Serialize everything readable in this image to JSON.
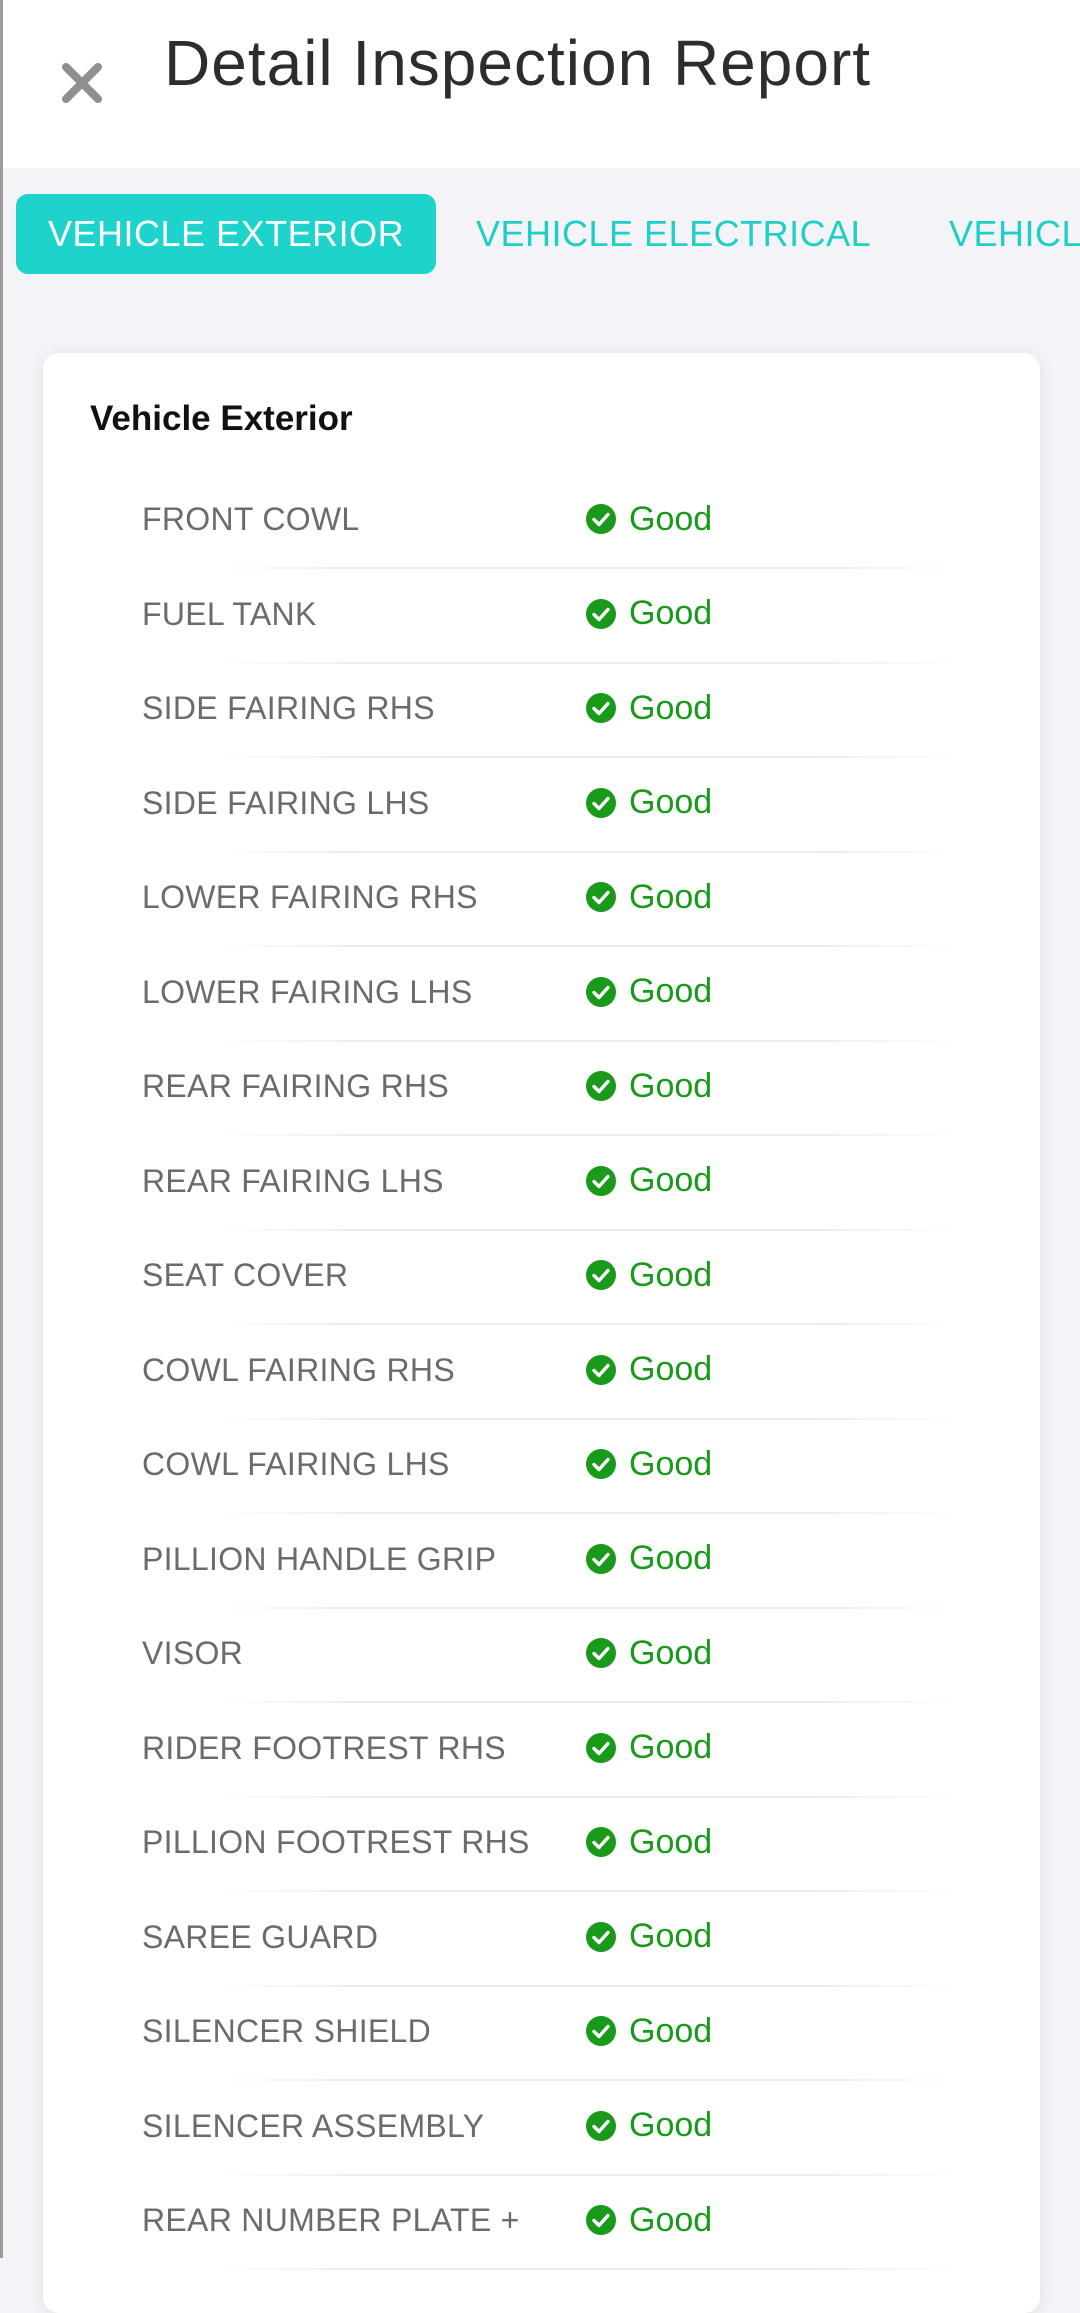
{
  "header": {
    "title": "Detail Inspection Report",
    "close_icon": "close-icon"
  },
  "tabs": [
    {
      "label": "VEHICLE EXTERIOR",
      "active": true
    },
    {
      "label": "VEHICLE ELECTRICAL",
      "active": false
    },
    {
      "label": "VEHICL",
      "active": false
    }
  ],
  "section": {
    "title": "Vehicle Exterior",
    "status_icon": "check-circle-icon",
    "status_color": "#1a9a1a",
    "items": [
      {
        "label": "FRONT COWL",
        "status": "Good"
      },
      {
        "label": "FUEL TANK",
        "status": "Good"
      },
      {
        "label": "SIDE FAIRING RHS",
        "status": "Good"
      },
      {
        "label": "SIDE FAIRING LHS",
        "status": "Good"
      },
      {
        "label": "LOWER FAIRING RHS",
        "status": "Good"
      },
      {
        "label": "LOWER FAIRING LHS",
        "status": "Good"
      },
      {
        "label": "REAR FAIRING RHS",
        "status": "Good"
      },
      {
        "label": "REAR FAIRING LHS",
        "status": "Good"
      },
      {
        "label": "SEAT COVER",
        "status": "Good"
      },
      {
        "label": "COWL FAIRING RHS",
        "status": "Good"
      },
      {
        "label": "COWL FAIRING LHS",
        "status": "Good"
      },
      {
        "label": "PILLION HANDLE GRIP",
        "status": "Good"
      },
      {
        "label": "VISOR",
        "status": "Good"
      },
      {
        "label": "RIDER FOOTREST RHS",
        "status": "Good"
      },
      {
        "label": "PILLION FOOTREST RHS",
        "status": "Good"
      },
      {
        "label": "SAREE GUARD",
        "status": "Good"
      },
      {
        "label": "SILENCER SHIELD",
        "status": "Good"
      },
      {
        "label": "SILENCER ASSEMBLY",
        "status": "Good"
      },
      {
        "label": "REAR NUMBER PLATE +",
        "status": "Good"
      }
    ]
  },
  "colors": {
    "accent": "#1dd3cb",
    "background": "#f4f3f7",
    "good": "#1a9a1a"
  }
}
